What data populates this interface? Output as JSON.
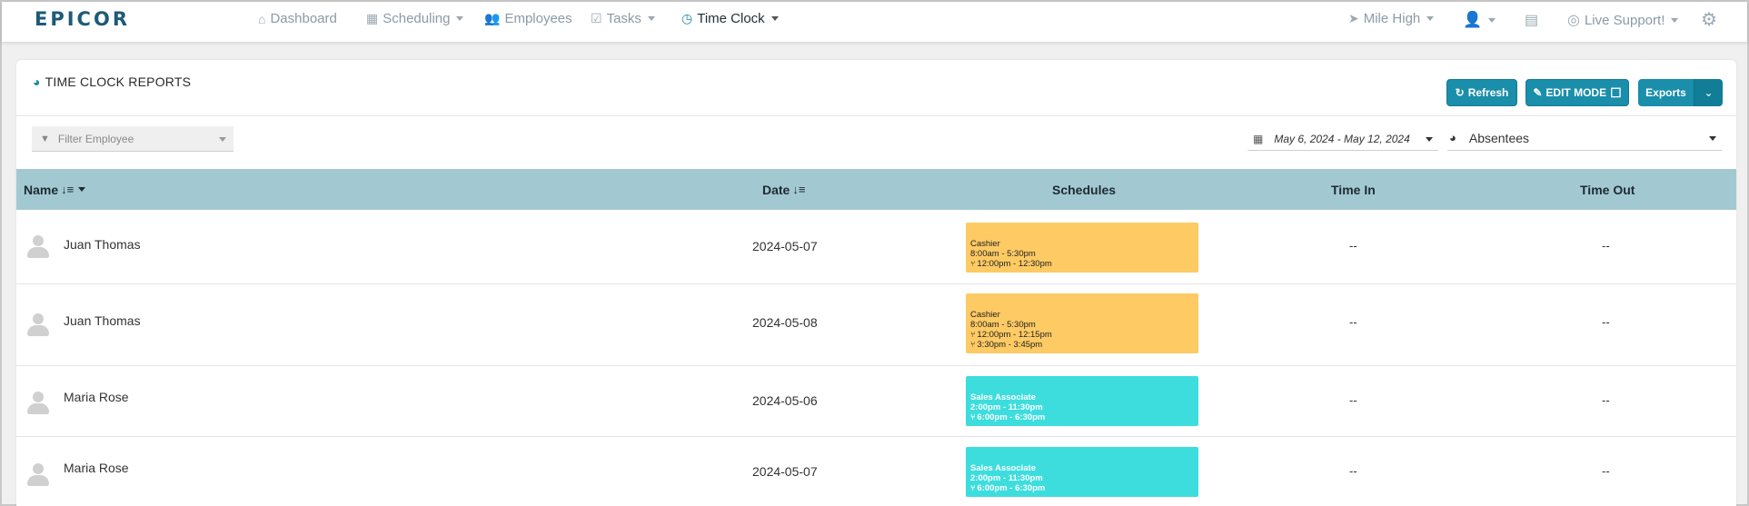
{
  "app": {
    "logo": "EPICOR"
  },
  "nav": {
    "items": [
      {
        "icon": "home-icon",
        "glyph": "⌂",
        "label": "Dashboard",
        "caret": false
      },
      {
        "icon": "calendar-icon",
        "glyph": "▦",
        "label": "Scheduling",
        "caret": true
      },
      {
        "icon": "users-icon",
        "glyph": "👥",
        "label": "Employees",
        "caret": false
      },
      {
        "icon": "checkbox-icon",
        "glyph": "☑",
        "label": "Tasks",
        "caret": true
      },
      {
        "icon": "clock-icon",
        "glyph": "◷",
        "label": "Time Clock",
        "caret": true,
        "active": true
      }
    ],
    "location": {
      "glyph": "➤",
      "label": "Mile High"
    },
    "user_glyph": "👤",
    "chat_glyph": "▤",
    "support": {
      "glyph": "◎",
      "label": "Live Support!"
    },
    "gear_glyph": "⚙"
  },
  "panel": {
    "title": "TIME CLOCK REPORTS",
    "title_glyph": "◕",
    "refresh_label": "Refresh",
    "refresh_glyph": "↻",
    "edit_mode_label": "EDIT MODE",
    "edit_glyph": "✎",
    "edit_box_glyph": "☐",
    "exports_label": "Exports",
    "exports_caret": "⌄"
  },
  "filters": {
    "employee_placeholder": "Filter Employee",
    "filter_glyph": "▼",
    "date_range": "May 6, 2024 - May 12, 2024",
    "date_glyph": "▦",
    "report_type": "Absentees",
    "report_glyph": "◕"
  },
  "table": {
    "headers": {
      "name": "Name",
      "date": "Date",
      "schedules": "Schedules",
      "time_in": "Time In",
      "time_out": "Time Out"
    },
    "sort_glyph": "↓≡",
    "rows": [
      {
        "name": "Juan Thomas",
        "date": "2024-05-07",
        "time_in": "--",
        "time_out": "--",
        "schedule": {
          "color": "#fdca64",
          "role": "Cashier",
          "hours": "8:00am - 5:30pm",
          "breaks": [
            "12:00pm - 12:30pm"
          ]
        }
      },
      {
        "name": "Juan Thomas",
        "date": "2024-05-08",
        "time_in": "--",
        "time_out": "--",
        "schedule": {
          "color": "#fdca64",
          "role": "Cashier",
          "hours": "8:00am - 5:30pm",
          "breaks": [
            "12:00pm - 12:15pm",
            "3:30pm - 3:45pm"
          ]
        }
      },
      {
        "name": "Maria Rose",
        "date": "2024-05-06",
        "time_in": "--",
        "time_out": "--",
        "schedule": {
          "color": "#3ddddd",
          "role": "Sales Associate",
          "hours": "2:00pm - 11:30pm",
          "breaks": [
            "6:00pm - 6:30pm"
          ]
        }
      },
      {
        "name": "Maria Rose",
        "date": "2024-05-07",
        "time_in": "--",
        "time_out": "--",
        "schedule": {
          "color": "#3ddddd",
          "role": "Sales Associate",
          "hours": "2:00pm - 11:30pm",
          "breaks": [
            "6:00pm - 6:30pm"
          ]
        }
      }
    ]
  },
  "fork_glyph": "⑂"
}
